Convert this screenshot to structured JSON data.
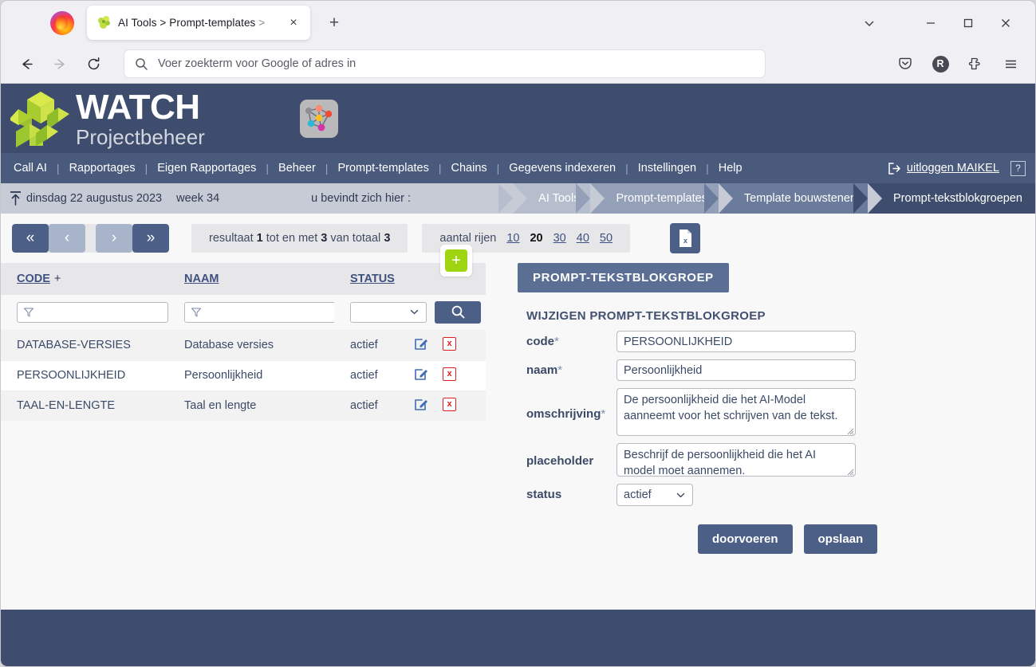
{
  "browser": {
    "tab": {
      "title_main": "AI Tools > Prompt-templates",
      "title_dim": " >",
      "favicon": "puzzle-green-icon",
      "close_label": "×"
    },
    "new_tab_label": "+",
    "window_controls": {
      "list_all_tabs": "⌄",
      "minimize": "—",
      "maximize": "□",
      "close": "✕"
    },
    "nav": {
      "back": "←",
      "forward": "→",
      "reload": "↻"
    },
    "urlbar": {
      "placeholder": "Voer zoekterm voor Google of adres in",
      "search_icon": "search-icon"
    },
    "toolbar_icons": {
      "pocket": "pocket-icon",
      "account_initial": "R",
      "extensions": "puzzle-piece-icon",
      "menu": "hamburger-menu-icon"
    }
  },
  "app": {
    "logo": {
      "title": "WATCH",
      "subtitle": "Projectbeheer"
    },
    "aitools_icon": "neural-network-icon",
    "menu": {
      "items": [
        "Call AI",
        "Rapportages",
        "Eigen Rapportages",
        "Beheer",
        "Prompt-templates",
        "Chains",
        "Gegevens indexeren",
        "Instellingen",
        "Help"
      ],
      "separator": "|",
      "logout_label": "uitloggen MAIKEL",
      "logout_icon": "logout-arrow-icon",
      "help_label": "?"
    },
    "breadcrumb": {
      "up_icon": "up-arrow-icon",
      "date": "dinsdag 22 augustus 2023",
      "week": "week 34",
      "here_label": "u bevindt zich hier :",
      "trail": [
        {
          "label": "AI Tools",
          "color": "#b6becd"
        },
        {
          "label": "Prompt-templates",
          "color": "#93a0b8"
        },
        {
          "label": "Template bouwstenen",
          "color": "#6b7b9c"
        },
        {
          "label": "Prompt-tekstblokgroepen",
          "color": "#3e4d6d"
        }
      ]
    },
    "toolbar": {
      "pager": {
        "first": "«",
        "prev": "‹",
        "next": "›",
        "last": "»"
      },
      "result_prefix": "resultaat",
      "result_from": "1",
      "result_mid": "tot en met",
      "result_to": "3",
      "result_of": "van totaal",
      "result_total": "3",
      "rows_label": "aantal rijen",
      "rows_options": [
        "10",
        "20",
        "30",
        "40",
        "50"
      ],
      "rows_selected": "20",
      "export_icon": "excel-export-icon"
    },
    "table": {
      "columns": [
        "CODE",
        "NAAM",
        "STATUS"
      ],
      "sort_indicator": "+",
      "filters": {
        "code_value": "",
        "naam_value": "",
        "status_value": ""
      },
      "search_icon": "search-icon",
      "add_label": "+",
      "rows": [
        {
          "code": "DATABASE-VERSIES",
          "naam": "Database versies",
          "status": "actief",
          "edit": "edit-icon",
          "delete": "x"
        },
        {
          "code": "PERSOONLIJKHEID",
          "naam": "Persoonlijkheid",
          "status": "actief",
          "edit": "edit-icon",
          "delete": "x"
        },
        {
          "code": "TAAL-EN-LENGTE",
          "naam": "Taal en lengte",
          "status": "actief",
          "edit": "edit-icon",
          "delete": "x"
        }
      ]
    },
    "form": {
      "panel_title": "PROMPT-TEKSTBLOKGROEP",
      "section_title": "WIJZIGEN PROMPT-TEKSTBLOKGROEP",
      "fields": {
        "code_label": "code",
        "code_value": "PERSOONLIJKHEID",
        "naam_label": "naam",
        "naam_value": "Persoonlijkheid",
        "omschrijving_label": "omschrijving",
        "omschrijving_value": "De persoonlijkheid die het AI-Model aanneemt voor het schrijven van de tekst.",
        "placeholder_label": "placeholder",
        "placeholder_value": "Beschrijf de persoonlijkheid die het AI model moet aannemen.",
        "status_label": "status",
        "status_value": "actief",
        "required_marker": "*"
      },
      "buttons": {
        "apply": "doorvoeren",
        "save": "opslaan"
      }
    }
  }
}
